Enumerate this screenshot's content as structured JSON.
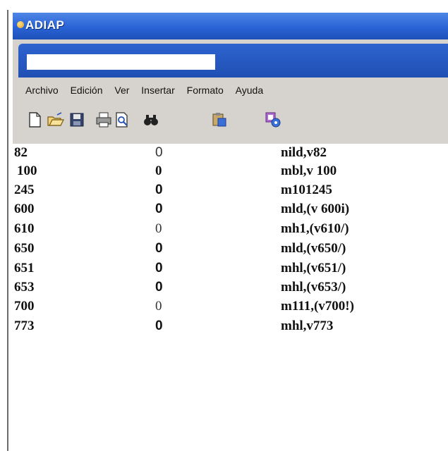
{
  "window": {
    "title": "ADIAP"
  },
  "menu": [
    "Archivo",
    "Edición",
    "Ver",
    "Insertar",
    "Formato",
    "Ayuda"
  ],
  "toolbar": [
    "new-icon",
    "open-icon",
    "save-icon",
    "print-icon",
    "print-preview-icon",
    "find-icon",
    "paste-special-icon",
    "settings-icon"
  ],
  "rows": [
    {
      "code": "82",
      "value": "0",
      "mark": "nild,v82"
    },
    {
      "code": "100",
      "value": "0",
      "mark": "mbl,v 100"
    },
    {
      "code": "245",
      "value": "0",
      "mark": "m101245"
    },
    {
      "code": "600",
      "value": "0",
      "mark": "mld,(v 600i)"
    },
    {
      "code": "610",
      "value": "0",
      "mark": "mh1,(v610/)"
    },
    {
      "code": "650",
      "value": "0",
      "mark": "mld,(v650/)"
    },
    {
      "code": "651",
      "value": "0",
      "mark": "mhl,(v651/)"
    },
    {
      "code": "653",
      "value": "0",
      "mark": "mhl,(v653/)"
    },
    {
      "code": "700",
      "value": "0",
      "mark": "m111,(v700!)"
    },
    {
      "code": "773",
      "value": "0",
      "mark": "mhl,v773"
    }
  ]
}
